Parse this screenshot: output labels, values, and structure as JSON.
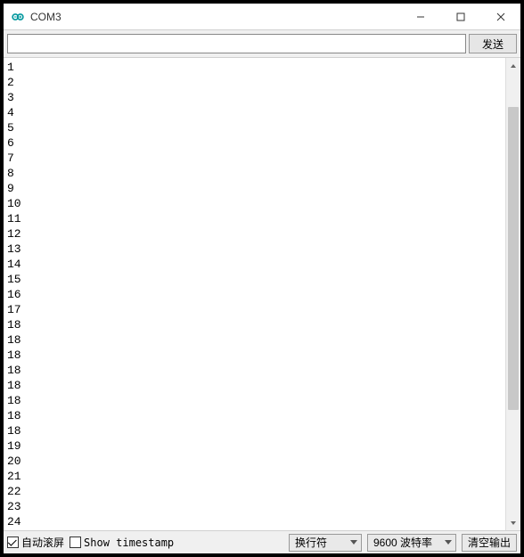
{
  "window": {
    "title": "COM3",
    "icon_color": "#00979D"
  },
  "top": {
    "input_value": "",
    "input_placeholder": "",
    "send_label": "发送"
  },
  "output_lines": [
    "1",
    "2",
    "3",
    "4",
    "5",
    "6",
    "7",
    "8",
    "9",
    "10",
    "11",
    "12",
    "13",
    "14",
    "15",
    "16",
    "17",
    "18",
    "18",
    "18",
    "18",
    "18",
    "18",
    "18",
    "18",
    "19",
    "20",
    "21",
    "22",
    "23",
    "24"
  ],
  "bottom": {
    "autoscroll_label": "自动滚屏",
    "autoscroll_checked": true,
    "timestamp_label": "Show timestamp",
    "timestamp_checked": false,
    "line_ending_selected": "换行符",
    "baud_selected": "9600 波特率",
    "clear_label": "清空输出"
  }
}
